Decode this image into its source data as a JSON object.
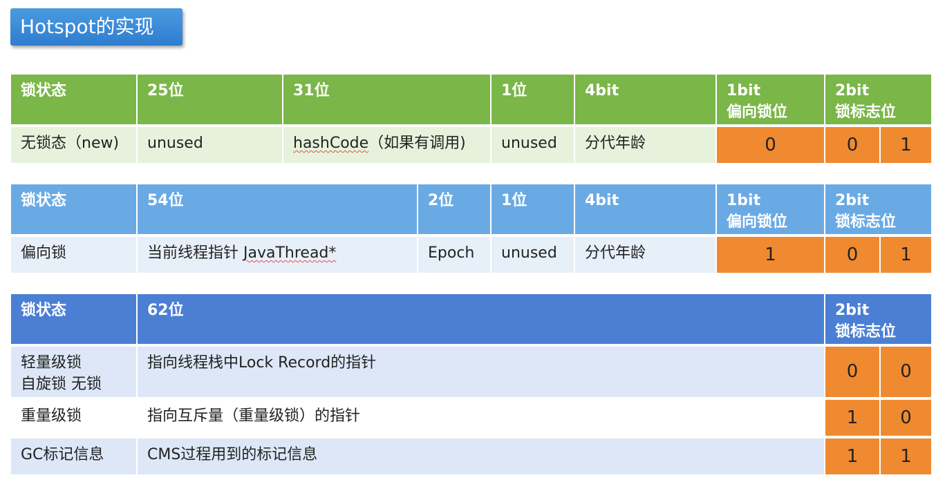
{
  "title": "Hotspot的实现",
  "table1": {
    "header": [
      "锁状态",
      "25位",
      "31位",
      "1位",
      "4bit",
      "1bit\n偏向锁位",
      "2bit\n锁标志位"
    ],
    "row": {
      "state": "无锁态（new)",
      "c25": "unused",
      "c31a": "hashCode",
      "c31b": "（如果有调用)",
      "c1": "unused",
      "age": "分代年龄",
      "biased": "0",
      "flag1": "0",
      "flag2": "1"
    }
  },
  "table2": {
    "header": [
      "锁状态",
      "54位",
      "2位",
      "1位",
      "4bit",
      "1bit\n偏向锁位",
      "2bit\n锁标志位"
    ],
    "row": {
      "state": "偏向锁",
      "c54a": "当前线程指针 ",
      "c54b": "JavaThread*",
      "epoch": "Epoch",
      "c1": "unused",
      "age": "分代年龄",
      "biased": "1",
      "flag1": "0",
      "flag2": "1"
    }
  },
  "table3": {
    "header": [
      "锁状态",
      "62位",
      "2bit\n锁标志位"
    ],
    "rows": [
      {
        "state": "轻量级锁\n自旋锁 无锁",
        "desc": "指向线程栈中Lock Record的指针",
        "f1": "0",
        "f2": "0"
      },
      {
        "state": "重量级锁",
        "desc": "指向互斥量（重量级锁）的指针",
        "f1": "1",
        "f2": "0"
      },
      {
        "state": "GC标记信息",
        "desc": "CMS过程用到的标记信息",
        "f1": "1",
        "f2": "1"
      }
    ]
  },
  "colors": {
    "green_header": "#7ab648",
    "blue_header": "#6aaae4",
    "dark_blue_header": "#4a7fd4",
    "orange": "#f08a30"
  }
}
